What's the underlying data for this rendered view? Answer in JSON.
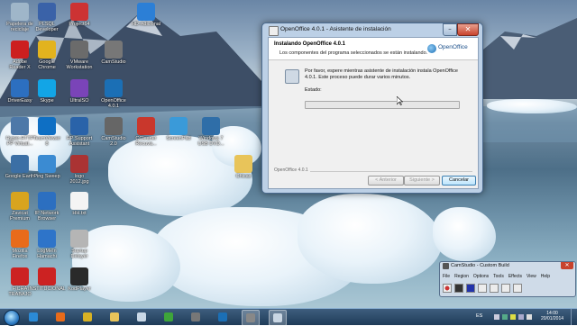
{
  "desktop_icons": [
    {
      "label": "Papelera de\nreciclaje",
      "icon": "recycle-bin-icon",
      "color": "#9fb6c9"
    },
    {
      "label": "PLSQL\nDeveloper",
      "icon": "plsql-icon",
      "color": "#3a62a8"
    },
    {
      "label": "Project64",
      "icon": "project64-icon",
      "color": "#c33"
    },
    {
      "label": "HD-Adicional",
      "icon": "hd-icon",
      "color": "#2c7fd6"
    },
    {
      "label": "Adobe\nReader X",
      "icon": "adobe-reader-icon",
      "color": "#cc1f1f"
    },
    {
      "label": "Google\nChrome",
      "icon": "chrome-icon",
      "color": "#e2b31e"
    },
    {
      "label": "VMware\nWorkstation",
      "icon": "vmware-icon",
      "color": "#6b6b6b"
    },
    {
      "label": "CamStudio",
      "icon": "camstudio-icon",
      "color": "#777"
    },
    {
      "label": "DriverEasy",
      "icon": "drivereasy-icon",
      "color": "#2c6fc0"
    },
    {
      "label": "Skype",
      "icon": "skype-icon",
      "color": "#12a5e6"
    },
    {
      "label": "UltraISO",
      "icon": "ultraiso-icon",
      "color": "#7a44b8"
    },
    {
      "label": "OpenOffice\n4.0.1",
      "icon": "openoffice-icon",
      "color": "#1b6fb5"
    },
    {
      "label": "Hyper-HTTP\nPP Virtual...",
      "icon": "app-icon",
      "color": "#4d78a8"
    },
    {
      "label": "TeamViewer\n8",
      "icon": "teamviewer-icon",
      "color": "#0e6fc4"
    },
    {
      "label": "HP Support\nAssistant",
      "icon": "hp-icon",
      "color": "#2a63a9"
    },
    {
      "label": "CamStudio\n2.0",
      "icon": "camstudio2-icon",
      "color": "#666"
    },
    {
      "label": "CCleaner\nRecuva...",
      "icon": "ccleaner-icon",
      "color": "#c9372c"
    },
    {
      "label": "ScreenPad",
      "icon": "screenpad-icon",
      "color": "#3a9ad9"
    },
    {
      "label": "Windows 7\nUSB DVD...",
      "icon": "windows-usb-icon",
      "color": "#2f6ea8"
    },
    {
      "label": "Google Earth",
      "icon": "google-earth-icon",
      "color": "#3b6fa5"
    },
    {
      "label": "Ping Sweep",
      "icon": "ping-icon",
      "color": "#3b8bd2"
    },
    {
      "label": "logo\n2012.jpg",
      "icon": "image-file-icon",
      "color": "#a33"
    },
    {
      "label": "Chicas",
      "icon": "folder-icon",
      "color": "#e8c45a"
    },
    {
      "label": "Zavicat\nPremium",
      "icon": "zavicat-icon",
      "color": "#d8a41e"
    },
    {
      "label": "IP Network\nBrowser",
      "icon": "ip-browser-icon",
      "color": "#2c6fc0"
    },
    {
      "label": "HH.txt",
      "icon": "text-file-icon",
      "color": "#f4f4f4"
    },
    {
      "label": "Mozilla\nFirefox",
      "icon": "firefox-icon",
      "color": "#e86b1a"
    },
    {
      "label": "LogMeIn\nHamachi",
      "icon": "hamachi-icon",
      "color": "#2e74c9"
    },
    {
      "label": "Startup\nDelayer",
      "icon": "startup-icon",
      "color": "#b5b5b5"
    },
    {
      "label": "FICHA\nTRABAJO",
      "icon": "document-icon",
      "color": "#c22"
    },
    {
      "label": "INSTITUCIONAL",
      "icon": "document-icon",
      "color": "#c22"
    },
    {
      "label": "KodPlayer",
      "icon": "player-icon",
      "color": "#2a2a2a"
    }
  ],
  "installer": {
    "title": "OpenOffice 4.0.1 - Asistente de instalación",
    "heading": "Instalando OpenOffice 4.0.1",
    "subheading": "Los componentes del programa seleccionados se están instalando.",
    "brand": "OpenOffice",
    "message": "Por favor, espere mientras asistente de instalación instala OpenOffice 4.0.1. Este proceso puede durar varios minutos.",
    "status_label": "Estado:",
    "progress_fraction": 0.0,
    "footer_label": "OpenOffice 4.0.1",
    "buttons": {
      "back": "< Anterior",
      "next": "Siguiente >",
      "cancel": "Cancelar"
    },
    "close_glyph": "✕",
    "minimize_glyph": "–"
  },
  "camstudio": {
    "title": "CamStudio - Custom Build",
    "menu": [
      "File",
      "Region",
      "Options",
      "Tools",
      "Effects",
      "View",
      "Help"
    ],
    "close_glyph": "✕"
  },
  "taskbar": {
    "language": "ES",
    "time": "14:00",
    "date": "20/01/2014",
    "apps": [
      {
        "icon": "ie-icon",
        "color": "#2b8ad6",
        "active": false
      },
      {
        "icon": "firefox-icon",
        "color": "#e86b1a",
        "active": false
      },
      {
        "icon": "chrome-icon",
        "color": "#d8b224",
        "active": false
      },
      {
        "icon": "explorer-icon",
        "color": "#e8c45a",
        "active": false
      },
      {
        "icon": "wifi-icon",
        "color": "#c9d8e6",
        "active": false
      },
      {
        "icon": "monitor-icon",
        "color": "#3ea53a",
        "active": false
      },
      {
        "icon": "vmware-icon",
        "color": "#777",
        "active": false
      },
      {
        "icon": "teamviewer-icon",
        "color": "#1b6fb5",
        "active": false
      },
      {
        "icon": "camstudio-icon",
        "color": "#888",
        "active": true
      },
      {
        "icon": "installer-icon",
        "color": "#c9d6e3",
        "active": true
      }
    ]
  }
}
